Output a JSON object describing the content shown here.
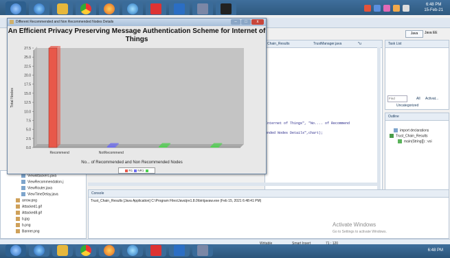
{
  "taskbar": {
    "clock_time": "6:48 PM",
    "clock_date": "15-Feb-21",
    "bottom_clock_time": "6:48 PM"
  },
  "dialog": {
    "window_title": "Different Recommended and Non Recommended Nodes Details",
    "minimize_label": "–",
    "maximize_label": "□",
    "close_label": "x"
  },
  "chart_data": {
    "type": "bar",
    "title": "An Efficient Privacy Preserving Message Authentication Scheme for Internet of Things",
    "xlabel": "No... of Recommended and Non Recommended Nodes",
    "ylabel": "Total Nodes",
    "categories": [
      "Recommend",
      "NotRecommend"
    ],
    "category_labels": [
      "Recommend",
      "NotRecommend",
      "",
      ""
    ],
    "ylim": [
      0,
      27.5
    ],
    "yticks": [
      0.0,
      2.5,
      5.0,
      7.5,
      10.0,
      12.5,
      15.0,
      17.5,
      20.0,
      22.5,
      25.0,
      27.5
    ],
    "series": [
      {
        "name": "R1",
        "values": [
          28,
          0
        ],
        "color": "#e8584a"
      },
      {
        "name": "NR1",
        "values": [
          0,
          0
        ],
        "color": "#6b6bf0"
      },
      {
        "name": "",
        "values": [
          0,
          0
        ],
        "color": "#4dd24d"
      }
    ],
    "legend": {
      "placement": "bottom-center",
      "items": [
        "R1",
        "NR1",
        ""
      ]
    },
    "grid": false
  },
  "editor": {
    "tabs": [
      "Chain_Results",
      "TrustManager.java",
      "*u"
    ],
    "code_lines": [
      "Internet of Things\", \"No.... of Recommend",
      "ended Nodes Details\",chart);"
    ]
  },
  "right_panel": {
    "task_list_label": "Task List",
    "find_placeholder": "Find",
    "all_label": "All",
    "activate_label": "Activat...",
    "uncategorized_label": "Uncategorized",
    "outline_label": "Outline",
    "outline_items": [
      "import declarations",
      "Trust_Chain_Results",
      "main(String[]) : voi"
    ],
    "perspective_java": "Java",
    "perspective_javaee": "Java EE"
  },
  "project_tree": {
    "items": [
      "ViewAttackers.java",
      "ViewRecommendation.j",
      "ViewRouter.java",
      "ViewTimeDelay.java",
      "arrow.png",
      "Attacked1.gif",
      "Attacked8.gif",
      "b.jpg",
      "b.png",
      "Banner.png"
    ]
  },
  "console": {
    "label": "Console",
    "line": "Trust_Chain_Results [Java Application] C:\\Program Files\\Java\\jre1.8.0\\bin\\javaw.exe (Feb 15, 2021 6:48:41 PM)"
  },
  "statusbar": {
    "writable": "Writable",
    "insert_mode": "Smart Insert",
    "position": "71 : 120"
  },
  "watermark": {
    "line1": "Activate Windows",
    "line2": "Go to Settings to activate Windows."
  }
}
